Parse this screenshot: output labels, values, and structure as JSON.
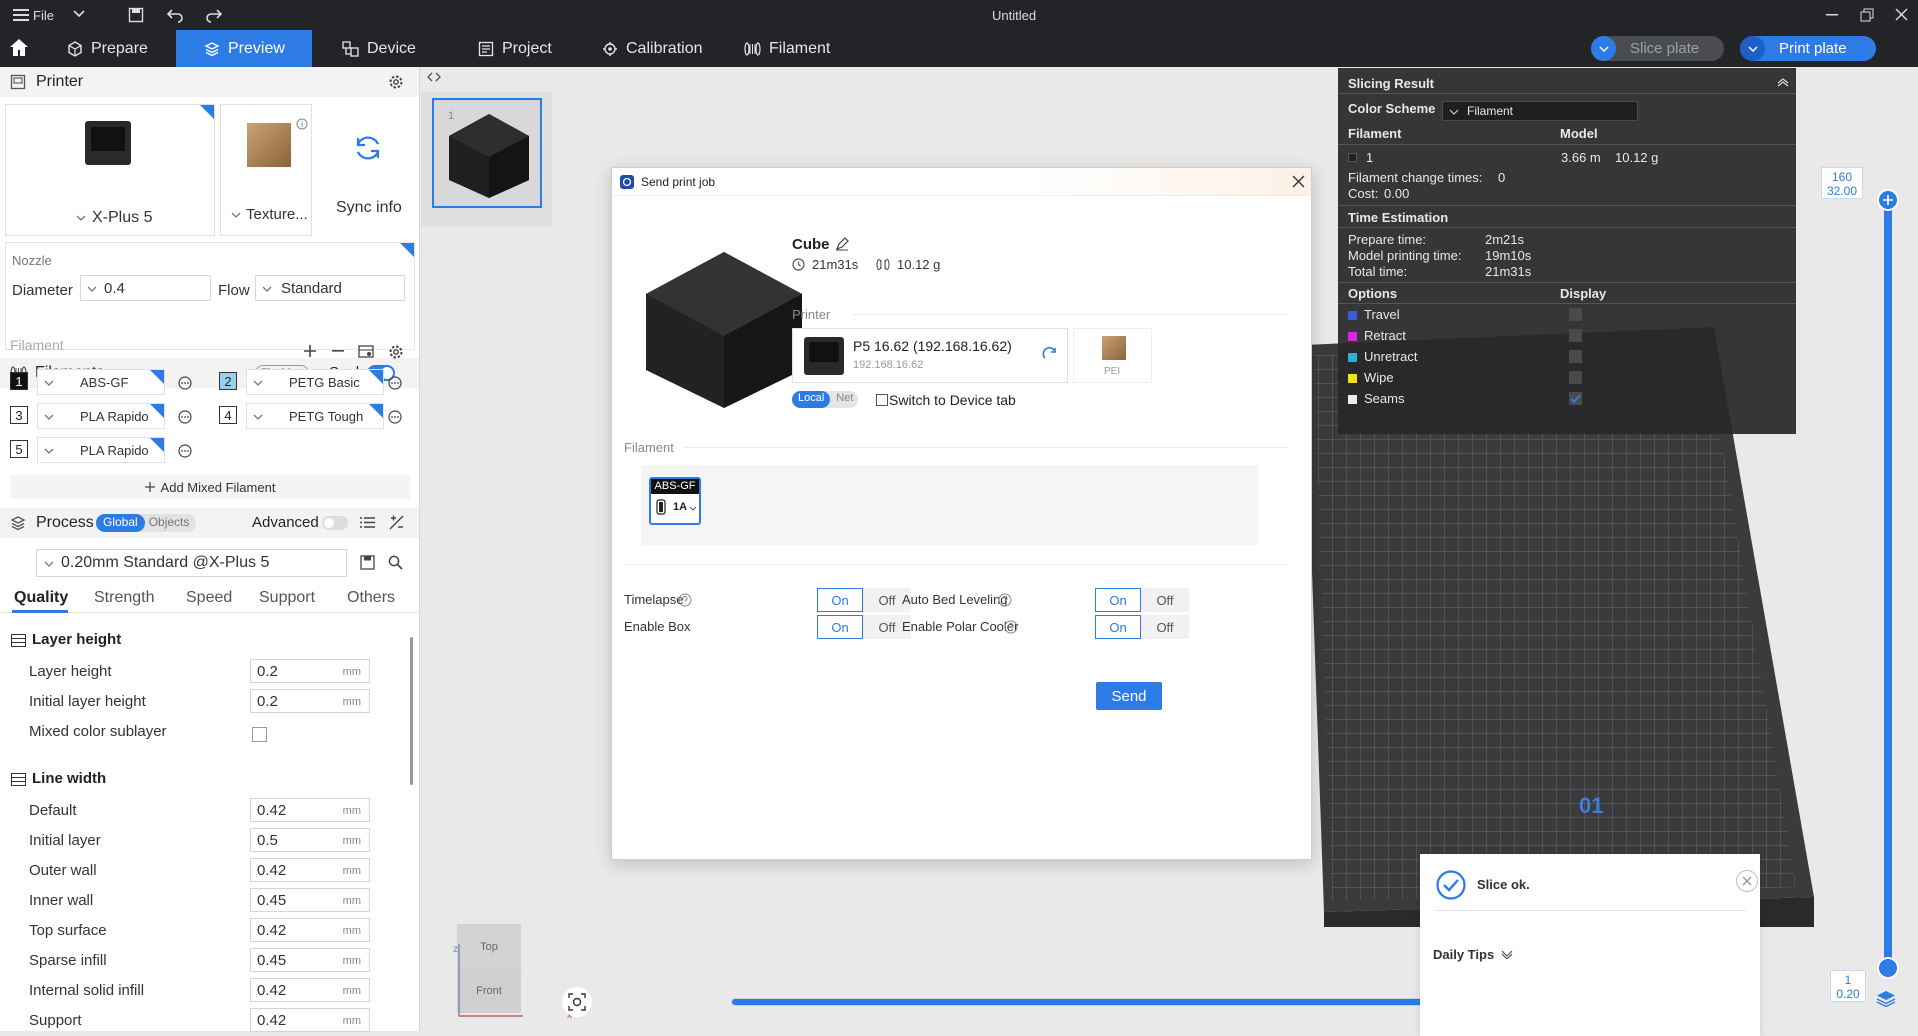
{
  "window": {
    "file_label": "File",
    "title": "Untitled"
  },
  "menu": {
    "tabs": [
      "Prepare",
      "Preview",
      "Device",
      "Project",
      "Calibration",
      "Filament"
    ],
    "slice_plate": "Slice plate",
    "print_plate": "Print plate"
  },
  "printer": {
    "header": "Printer",
    "machine": "X-Plus 5",
    "plate": "Texture...",
    "sync": "Sync info",
    "nozzle_label": "Nozzle",
    "diameter_label": "Diameter",
    "diameter_value": "0.4",
    "flow_label": "Flow",
    "flow_value": "Standard"
  },
  "filaments": {
    "header": "Filaments",
    "flushing": "Flushing",
    "seal": "Seal",
    "column_label": "Filament",
    "items": [
      {
        "num": "1",
        "name": "ABS-GF"
      },
      {
        "num": "2",
        "name": "PETG Basic"
      },
      {
        "num": "3",
        "name": "PLA Rapido"
      },
      {
        "num": "4",
        "name": "PETG Tough"
      },
      {
        "num": "5",
        "name": "PLA Rapido"
      }
    ],
    "add_mixed": "Add Mixed Filament"
  },
  "process": {
    "header": "Process",
    "global": "Global",
    "objects": "Objects",
    "advanced": "Advanced",
    "preset": "0.20mm Standard @X-Plus 5",
    "tabs": [
      "Quality",
      "Strength",
      "Speed",
      "Support",
      "Others"
    ],
    "layer_height_group": "Layer height",
    "line_width_group": "Line width",
    "unit": "mm",
    "rows": {
      "layer_height": {
        "label": "Layer height",
        "value": "0.2"
      },
      "initial_layer_height": {
        "label": "Initial layer height",
        "value": "0.2"
      },
      "mixed_color_sublayer": {
        "label": "Mixed color sublayer"
      },
      "default": {
        "label": "Default",
        "value": "0.42"
      },
      "initial_layer": {
        "label": "Initial layer",
        "value": "0.5"
      },
      "outer_wall": {
        "label": "Outer wall",
        "value": "0.42"
      },
      "inner_wall": {
        "label": "Inner wall",
        "value": "0.45"
      },
      "top_surface": {
        "label": "Top surface",
        "value": "0.42"
      },
      "sparse_infill": {
        "label": "Sparse infill",
        "value": "0.45"
      },
      "internal_solid_infill": {
        "label": "Internal solid infill",
        "value": "0.42"
      },
      "support": {
        "label": "Support",
        "value": "0.42"
      }
    }
  },
  "plate_thumb": {
    "index": "1"
  },
  "dialog": {
    "title": "Send print job",
    "model_name": "Cube",
    "time": "21m31s",
    "weight": "10.12 g",
    "printer_label": "Printer",
    "printer_name": "P5 16.62 (192.168.16.62)",
    "printer_ip": "192.168.16.62",
    "plate_type": "PEI",
    "local": "Local",
    "net": "Net",
    "switch_device": "Switch to Device tab",
    "filament_label": "Filament",
    "filament_name": "ABS-GF",
    "filament_slot": "1A",
    "timelapse": "Timelapse",
    "enable_box": "Enable Box",
    "auto_bed_leveling": "Auto Bed Leveling",
    "polar_cooler": "Enable Polar Cooler",
    "on": "On",
    "off": "Off",
    "send": "Send"
  },
  "slicing_result": {
    "title": "Slicing Result",
    "color_scheme_label": "Color Scheme",
    "color_scheme_value": "Filament",
    "filament_col": "Filament",
    "model_col": "Model",
    "filament_index": "1",
    "length": "3.66 m",
    "weight": "10.12 g",
    "change_times_label": "Filament change times:",
    "change_times": "0",
    "cost_label": "Cost:",
    "cost": "0.00",
    "time_estimation": "Time Estimation",
    "prepare_label": "Prepare time:",
    "prepare": "2m21s",
    "model_time_label": "Model printing time:",
    "model_time": "19m10s",
    "total_label": "Total time:",
    "total": "21m31s",
    "options_label": "Options",
    "display_label": "Display",
    "options": [
      {
        "name": "Travel",
        "color": "#3a5bd9",
        "checked": false
      },
      {
        "name": "Retract",
        "color": "#d62ad6",
        "checked": false
      },
      {
        "name": "Unretract",
        "color": "#2ab0d6",
        "checked": false
      },
      {
        "name": "Wipe",
        "color": "#f0e020",
        "checked": false
      },
      {
        "name": "Seams",
        "color": "#ececec",
        "checked": true
      }
    ]
  },
  "layer_slider": {
    "top_layer": "160",
    "top_height": "32.00",
    "bottom_layer": "1",
    "bottom_height": "0.20"
  },
  "move_slider": {
    "value": "121"
  },
  "plate_label": "01",
  "view_cube": {
    "top": "Top",
    "front": "Front",
    "axis_x": "x",
    "axis_z": "z"
  },
  "toast": {
    "message": "Slice ok.",
    "tips": "Daily Tips"
  }
}
